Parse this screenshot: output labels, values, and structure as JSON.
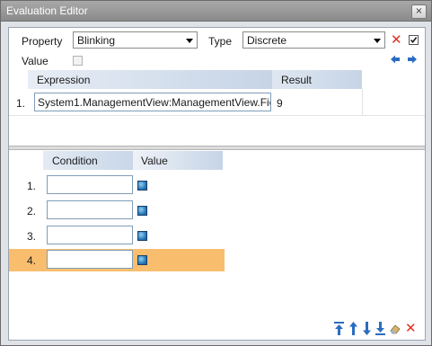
{
  "window": {
    "title": "Evaluation Editor",
    "close_glyph": "×"
  },
  "toolbar": {
    "property_label": "Property",
    "property_value": "Blinking",
    "type_label": "Type",
    "type_value": "Discrete",
    "value_label": "Value",
    "value_checked": false,
    "type_checked": true
  },
  "expression_table": {
    "columns": [
      "Expression",
      "Result"
    ],
    "rows": [
      {
        "index": "1.",
        "expression": "System1.ManagementView:ManagementView.Fie",
        "result": "9"
      }
    ]
  },
  "condition_table": {
    "columns": [
      "Condition",
      "Value"
    ],
    "rows": [
      {
        "index": "1.",
        "condition": "",
        "selected": false
      },
      {
        "index": "2.",
        "condition": "",
        "selected": false
      },
      {
        "index": "3.",
        "condition": "",
        "selected": false
      },
      {
        "index": "4.",
        "condition": "",
        "selected": true
      }
    ]
  },
  "colors": {
    "accent_blue": "#2b6cc0",
    "delete_red": "#e0301e",
    "selected_row": "#f8be6e",
    "header_gradient_end": "#c6d4e6",
    "value_swatch": "#1f6fb0"
  },
  "icons": {
    "close": "close-icon",
    "delete": "delete-icon",
    "nav_left": "arrow-left-icon",
    "nav_right": "arrow-right-icon",
    "move_top": "move-to-top-icon",
    "move_up": "move-up-icon",
    "move_down": "move-down-icon",
    "move_bottom": "move-to-bottom-icon",
    "clear": "eraser-icon",
    "remove": "remove-icon"
  }
}
